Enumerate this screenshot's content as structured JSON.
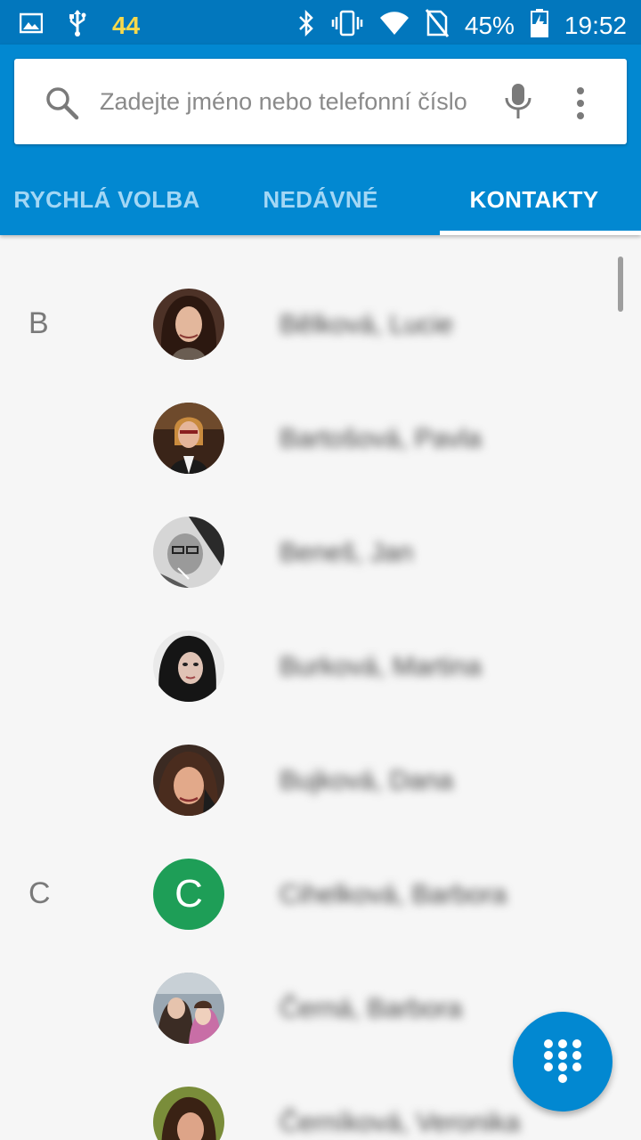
{
  "status_bar": {
    "notification_badge": "44",
    "battery_percent": "45%",
    "time": "19:52",
    "icons": [
      "image-icon",
      "usb-icon",
      "bluetooth-icon",
      "vibrate-icon",
      "wifi-icon",
      "no-sim-icon",
      "battery-charging-icon"
    ]
  },
  "search": {
    "placeholder": "Zadejte jméno nebo telefonní číslo",
    "value": ""
  },
  "tabs": [
    {
      "label": "RYCHLÁ VOLBA",
      "active": false
    },
    {
      "label": "NEDÁVNÉ",
      "active": false
    },
    {
      "label": "KONTAKTY",
      "active": true
    }
  ],
  "contacts": [
    {
      "letter": "B",
      "name": "Bělková, Lucie"
    },
    {
      "letter": "",
      "name": "Bartošová, Pavla"
    },
    {
      "letter": "",
      "name": "Beneš, Jan"
    },
    {
      "letter": "",
      "name": "Burková, Martina"
    },
    {
      "letter": "",
      "name": "Bujková, Dana"
    },
    {
      "letter": "C",
      "name": "Cihelková, Barbora",
      "initial": "C"
    },
    {
      "letter": "",
      "name": "Černá, Barbora"
    },
    {
      "letter": "",
      "name": "Černíková, Veronika"
    }
  ],
  "colors": {
    "app_bar": "#0288d1",
    "status_bar": "#0277bd",
    "initial_avatar": "#1e9e57"
  }
}
